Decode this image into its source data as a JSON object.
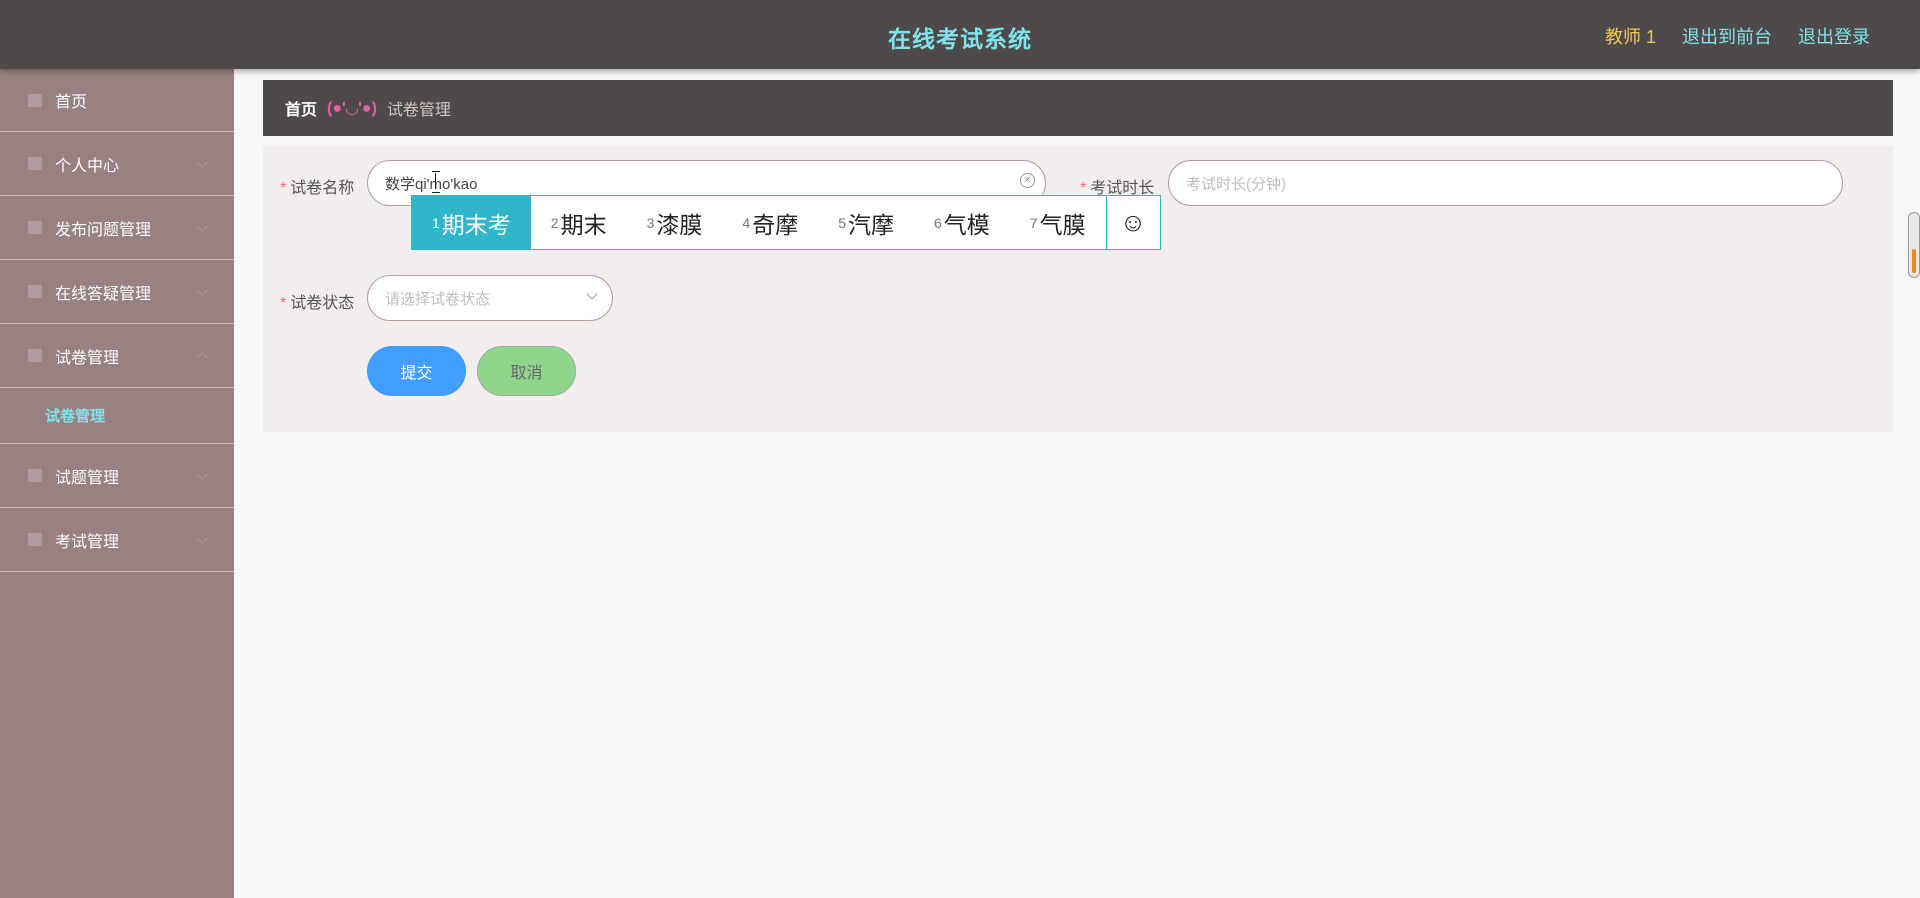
{
  "header": {
    "title": "在线考试系统",
    "user": "教师 1",
    "back_to_front": "退出到前台",
    "logout": "退出登录"
  },
  "sidebar": {
    "items": [
      {
        "label": "首页",
        "icon": "home-icon"
      },
      {
        "label": "个人中心",
        "icon": "user-icon"
      },
      {
        "label": "发布问题管理",
        "icon": "briefcase-icon"
      },
      {
        "label": "在线答疑管理",
        "icon": "document-icon"
      },
      {
        "label": "试卷管理",
        "icon": "paper-icon",
        "expanded": true
      },
      {
        "label": "试题管理",
        "icon": "list-icon"
      },
      {
        "label": "考试管理",
        "icon": "exam-icon"
      }
    ],
    "submenu": {
      "label": "试卷管理"
    }
  },
  "breadcrumb": {
    "home": "首页",
    "separator": "(●'◡'●)",
    "current": "试卷管理"
  },
  "form": {
    "name_label": "试卷名称",
    "name_value": "数学qi'mo'kao",
    "duration_label": "考试时长",
    "duration_placeholder": "考试时长(分钟)",
    "status_label": "试卷状态",
    "status_placeholder": "请选择试卷状态",
    "submit": "提交",
    "cancel": "取消",
    "required_mark": "*"
  },
  "ime": {
    "candidates": [
      {
        "num": "1",
        "text": "期末考"
      },
      {
        "num": "2",
        "text": "期末"
      },
      {
        "num": "3",
        "text": "漆膜"
      },
      {
        "num": "4",
        "text": "奇摩"
      },
      {
        "num": "5",
        "text": "汽摩"
      },
      {
        "num": "6",
        "text": "气模"
      },
      {
        "num": "7",
        "text": "气膜"
      }
    ],
    "emoji": "☺"
  },
  "colors": {
    "header_bg": "#4f4a4a",
    "title": "#7fe3ec",
    "sidebar_bg": "#9a8181",
    "accent": "#409eff",
    "ime_active": "#2fb7c9"
  }
}
